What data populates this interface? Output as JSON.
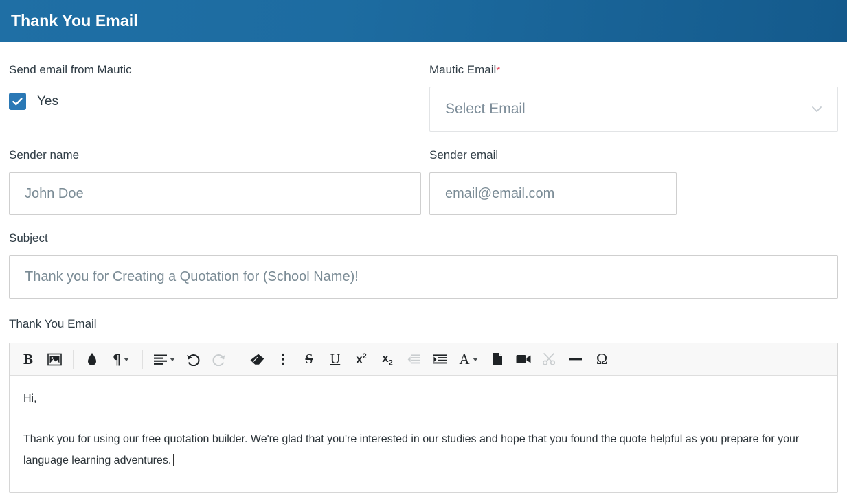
{
  "header": {
    "title": "Thank You Email"
  },
  "form": {
    "send_from_mautic": {
      "label": "Send email from Mautic",
      "checkbox_label": "Yes",
      "checked": true,
      "accent_color": "#2a78b5"
    },
    "mautic_email": {
      "label": "Mautic Email",
      "required_marker": "*",
      "required_color": "#e4485d",
      "selected_value": "Select Email"
    },
    "sender_name": {
      "label": "Sender name",
      "value": "",
      "placeholder": "John Doe"
    },
    "sender_email": {
      "label": "Sender email",
      "value": "",
      "placeholder": "email@email.com"
    },
    "subject": {
      "label": "Subject",
      "value": "",
      "placeholder": "Thank you for Creating a Quotation for (School Name)!"
    },
    "thank_you_email": {
      "label": "Thank You Email",
      "body_paragraphs": [
        "Hi,",
        "Thank you for using our free quotation builder. We're glad that you're interested in our studies and hope that you found the quote helpful as you prepare for your language learning adventures."
      ]
    }
  },
  "editor_toolbar": {
    "groups": [
      {
        "items": [
          {
            "name": "bold-icon",
            "label": "B",
            "kind": "glyph-bold",
            "disabled": false
          },
          {
            "name": "insert-image-icon",
            "label": "",
            "kind": "image",
            "disabled": false
          }
        ]
      },
      {
        "items": [
          {
            "name": "text-color-drop-icon",
            "label": "",
            "kind": "drop",
            "disabled": false
          },
          {
            "name": "paragraph-format-icon",
            "label": "¶",
            "kind": "glyph-para",
            "caret": true,
            "disabled": false
          }
        ]
      },
      {
        "items": [
          {
            "name": "align-icon",
            "label": "",
            "kind": "align",
            "caret": true,
            "disabled": false
          },
          {
            "name": "undo-icon",
            "label": "",
            "kind": "undo",
            "disabled": false
          },
          {
            "name": "redo-icon",
            "label": "",
            "kind": "redo",
            "disabled": true
          }
        ]
      },
      {
        "items": [
          {
            "name": "clear-formatting-eraser-icon",
            "label": "",
            "kind": "eraser",
            "disabled": false
          },
          {
            "name": "more-options-icon",
            "label": "",
            "kind": "dots",
            "disabled": false
          },
          {
            "name": "strikethrough-icon",
            "label": "S",
            "kind": "glyph-strike",
            "disabled": false
          },
          {
            "name": "underline-icon",
            "label": "U",
            "kind": "glyph-under",
            "disabled": false
          },
          {
            "name": "superscript-icon",
            "label": "x",
            "kind": "glyph-sup",
            "sup": "2",
            "disabled": false
          },
          {
            "name": "subscript-icon",
            "label": "x",
            "kind": "glyph-sub",
            "sub": "2",
            "disabled": false
          },
          {
            "name": "outdent-icon",
            "label": "",
            "kind": "outdent",
            "disabled": true
          },
          {
            "name": "indent-icon",
            "label": "",
            "kind": "indent",
            "disabled": false
          },
          {
            "name": "font-family-icon",
            "label": "A",
            "kind": "glyph-a",
            "caret": true,
            "disabled": false
          },
          {
            "name": "insert-file-icon",
            "label": "",
            "kind": "file",
            "disabled": false
          },
          {
            "name": "insert-video-icon",
            "label": "",
            "kind": "video",
            "disabled": false
          },
          {
            "name": "cut-scissors-icon",
            "label": "",
            "kind": "scissors",
            "disabled": true
          },
          {
            "name": "horizontal-rule-icon",
            "label": "",
            "kind": "hr",
            "disabled": false
          },
          {
            "name": "special-character-icon",
            "label": "Ω",
            "kind": "glyph-omega",
            "disabled": false
          }
        ]
      }
    ]
  }
}
